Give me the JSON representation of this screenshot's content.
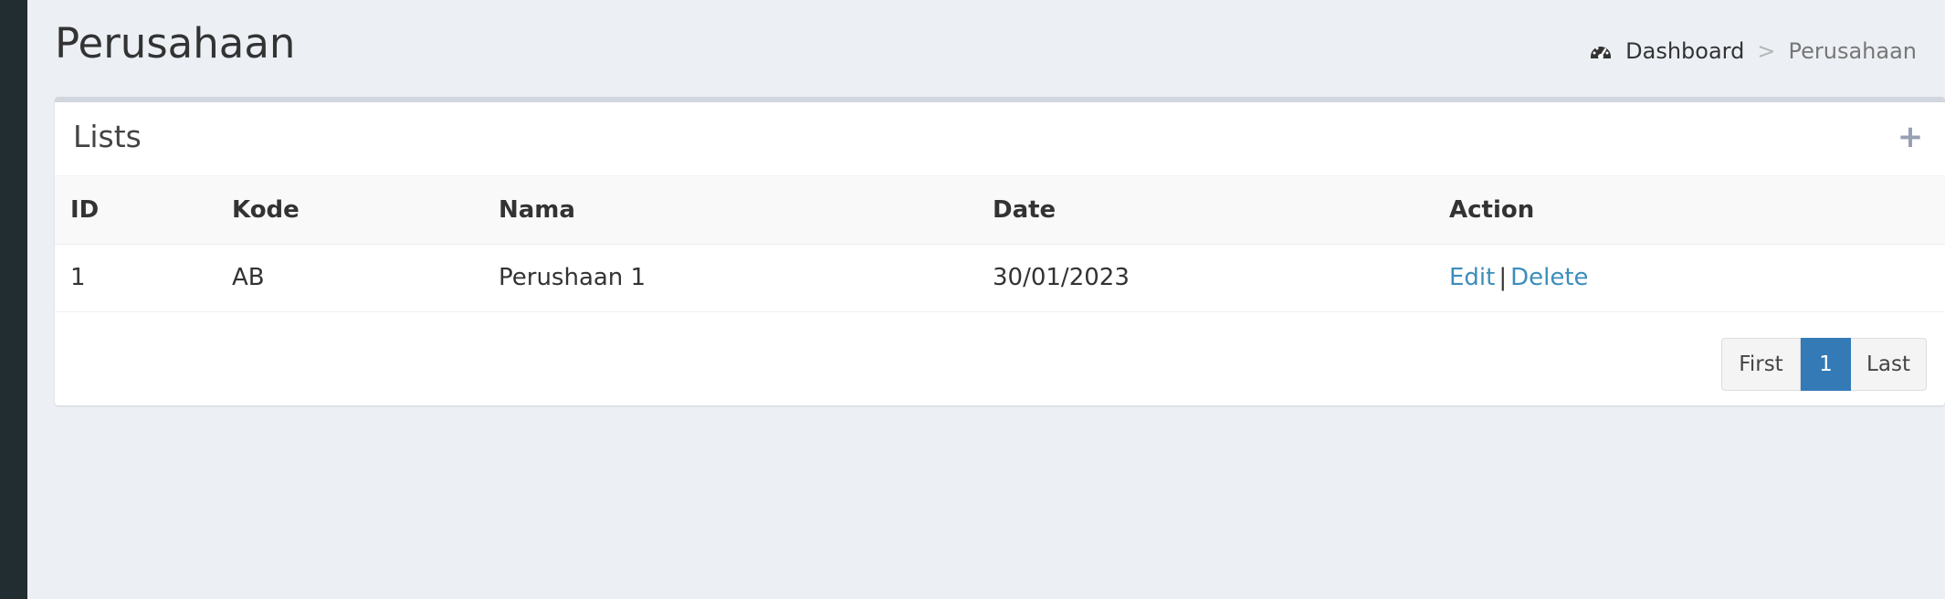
{
  "page": {
    "title": "Perusahaan"
  },
  "breadcrumb": {
    "icon": "dashboard-icon",
    "items": [
      "Dashboard",
      "Perusahaan"
    ],
    "separator": ">"
  },
  "box": {
    "title": "Lists",
    "add_icon": "plus-icon",
    "add_label": "+"
  },
  "table": {
    "headers": [
      "ID",
      "Kode",
      "Nama",
      "Date",
      "Action"
    ],
    "rows": [
      {
        "id": "1",
        "kode": "AB",
        "nama": "Perushaan 1",
        "date": "30/01/2023",
        "actions": [
          "Edit",
          "Delete"
        ],
        "action_separator": "|"
      }
    ]
  },
  "pagination": {
    "first": "First",
    "current": "1",
    "last": "Last"
  },
  "colors": {
    "sidebar": "#222d32",
    "background": "#ecf0f5",
    "link": "#3c8dbc",
    "active_page": "#337ab7"
  }
}
